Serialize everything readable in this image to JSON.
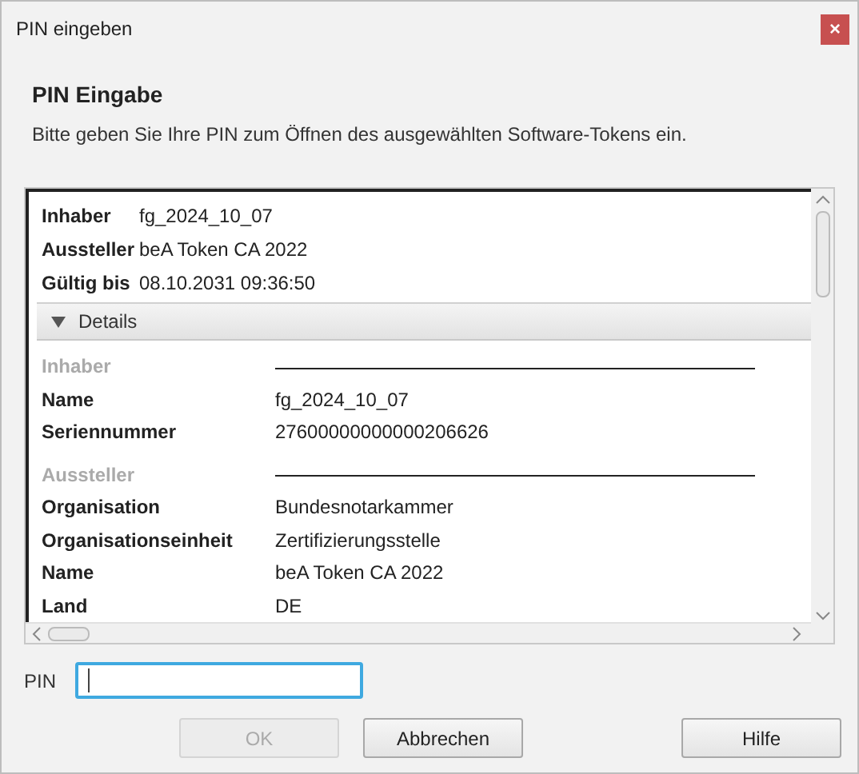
{
  "window": {
    "title": "PIN eingeben",
    "close": "×"
  },
  "header": {
    "title": "PIN Eingabe",
    "description": "Bitte geben Sie Ihre PIN zum Öffnen des ausgewählten Software-Tokens ein."
  },
  "summary": [
    {
      "label": "Inhaber",
      "value": "fg_2024_10_07"
    },
    {
      "label": "Aussteller",
      "value": "beA Token CA 2022"
    },
    {
      "label": "Gültig bis",
      "value": "08.10.2031 09:36:50"
    }
  ],
  "details": {
    "label": "Details",
    "expanded": true,
    "rows": [
      {
        "kind": "section",
        "label": "Inhaber"
      },
      {
        "kind": "field",
        "label": "Name",
        "value": "fg_2024_10_07"
      },
      {
        "kind": "field",
        "label": "Seriennummer",
        "value": "27600000000000206626"
      },
      {
        "kind": "section",
        "label": "Aussteller"
      },
      {
        "kind": "field",
        "label": "Organisation",
        "value": "Bundesnotarkammer"
      },
      {
        "kind": "field",
        "label": "Organisationseinheit",
        "value": "Zertifizierungsstelle"
      },
      {
        "kind": "field",
        "label": "Name",
        "value": "beA Token CA 2022"
      },
      {
        "kind": "field",
        "label": "Land",
        "value": "DE"
      }
    ]
  },
  "pin": {
    "label": "PIN",
    "focused": true
  },
  "buttons": [
    {
      "label": "OK",
      "disabled": true
    },
    {
      "label": "Abbrechen",
      "disabled": false
    },
    {
      "label": "Hilfe",
      "disabled": false
    }
  ]
}
